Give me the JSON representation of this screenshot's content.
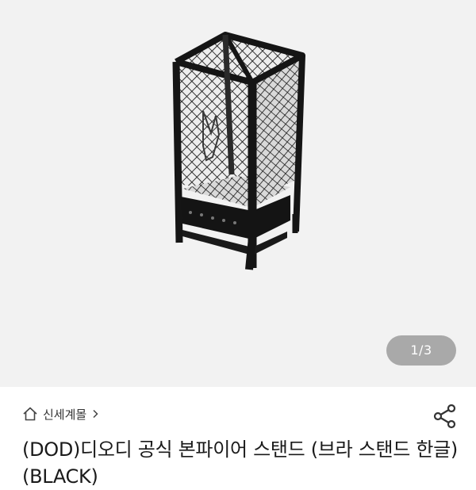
{
  "gallery": {
    "page_indicator": "1/3",
    "image_icon": "bonfire-stand-image"
  },
  "store": {
    "breadcrumb_label": "신세계몰",
    "home_icon": "home-icon",
    "chevron_icon": "chevron-right-icon"
  },
  "actions": {
    "share_icon": "share-icon"
  },
  "product": {
    "title": "(DOD)디오디 공식 본파이어 스탠드 (브라 스탠드 한글)(BLACK)"
  },
  "colors": {
    "gallery_bg": "#f2f2f2",
    "indicator_bg": "#a9a9a9",
    "text": "#1a1a1a"
  }
}
